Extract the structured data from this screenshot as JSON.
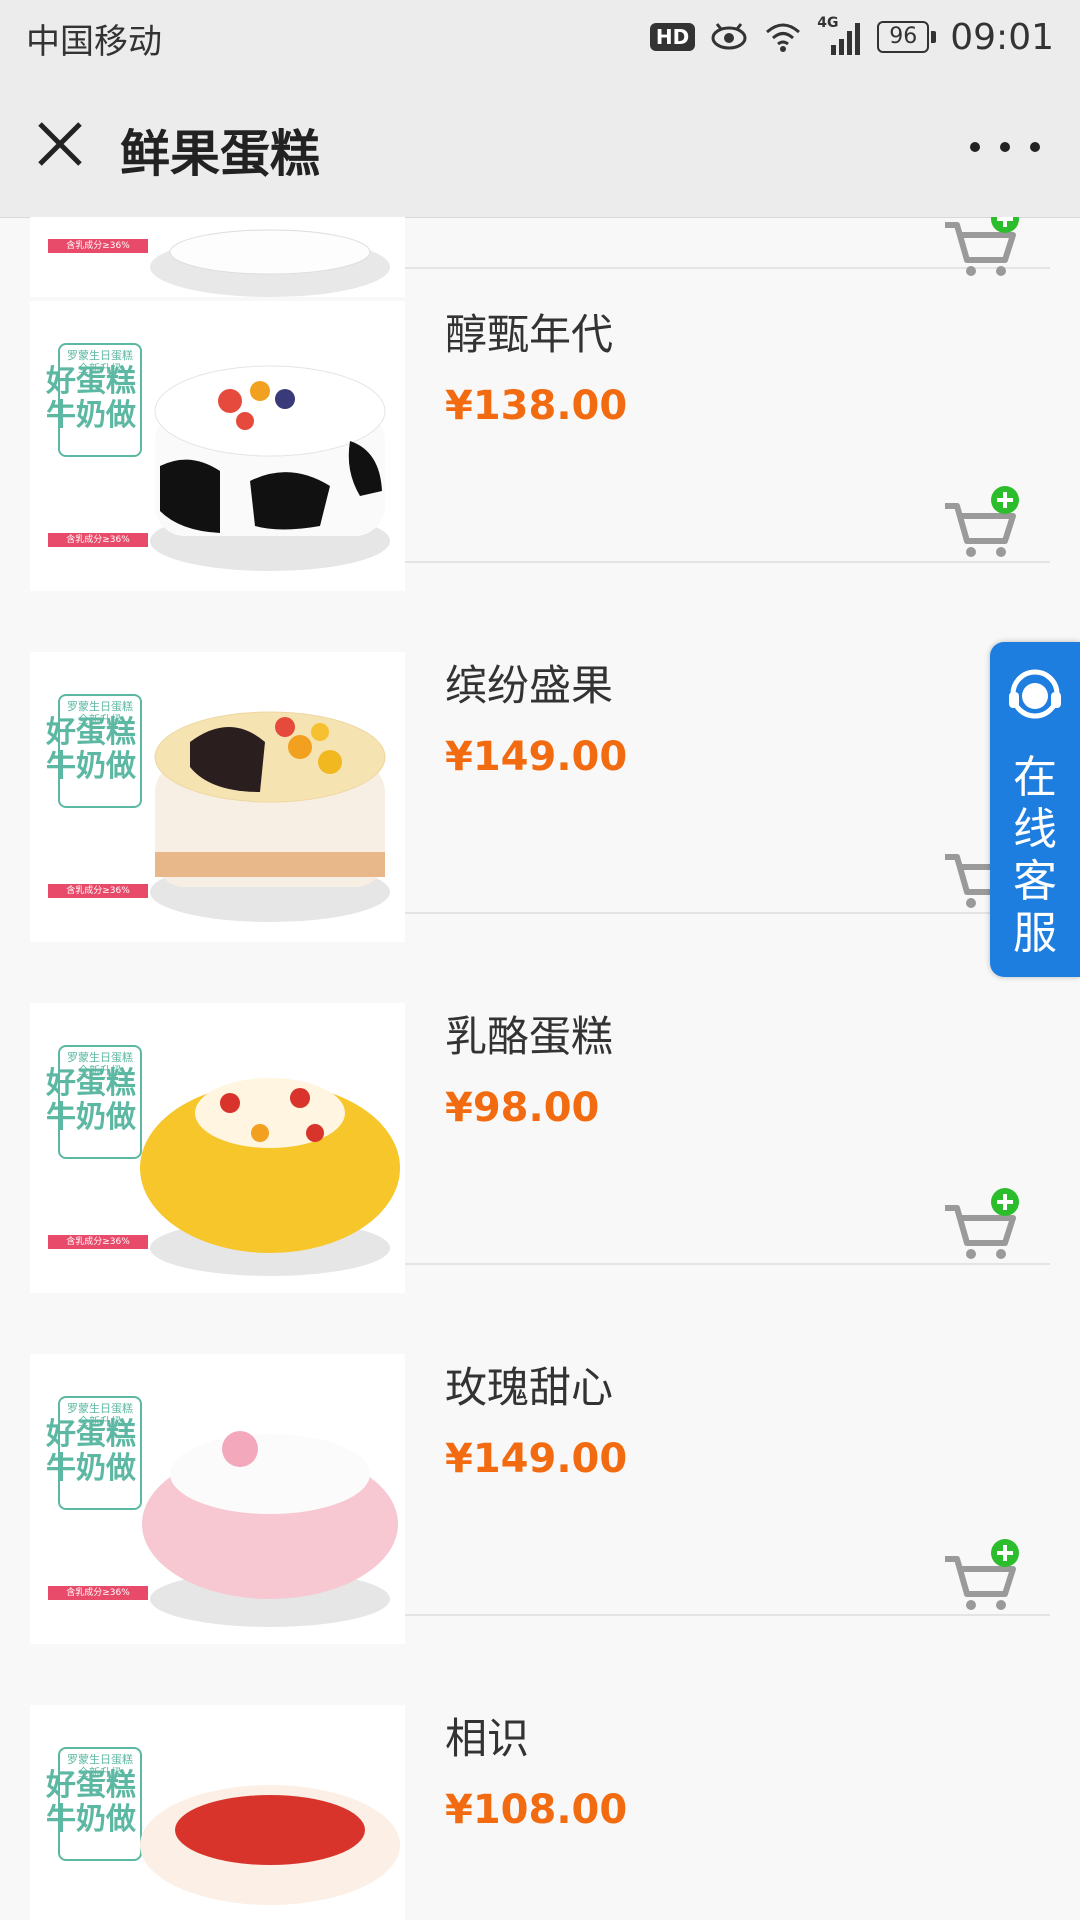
{
  "status_bar": {
    "carrier": "中国移动",
    "hd": "HD",
    "network": "4G",
    "battery": "96",
    "time": "09:01"
  },
  "header": {
    "title": "鲜果蛋糕"
  },
  "thumbnail_badge": {
    "small_line1": "罗蒙生日蛋糕",
    "small_line2": "全新升级",
    "big_line1": "好蛋糕",
    "big_line2": "牛奶做",
    "ribbon": "含乳成分≥36%"
  },
  "products": [
    {
      "name": "",
      "price": ""
    },
    {
      "name": "醇甄年代",
      "price": "¥138.00"
    },
    {
      "name": "缤纷盛果",
      "price": "¥149.00"
    },
    {
      "name": "乳酪蛋糕",
      "price": "¥98.00"
    },
    {
      "name": "玫瑰甜心",
      "price": "¥149.00"
    },
    {
      "name": "相识",
      "price": "¥108.00"
    }
  ],
  "service": {
    "label_line1": "在",
    "label_line2": "线",
    "label_line3": "客",
    "label_line4": "服"
  },
  "colors": {
    "price": "#f26b10",
    "cart_plus": "#2bbd2b",
    "service_bg": "#1e7ee0",
    "badge": "#5cb8a2"
  }
}
